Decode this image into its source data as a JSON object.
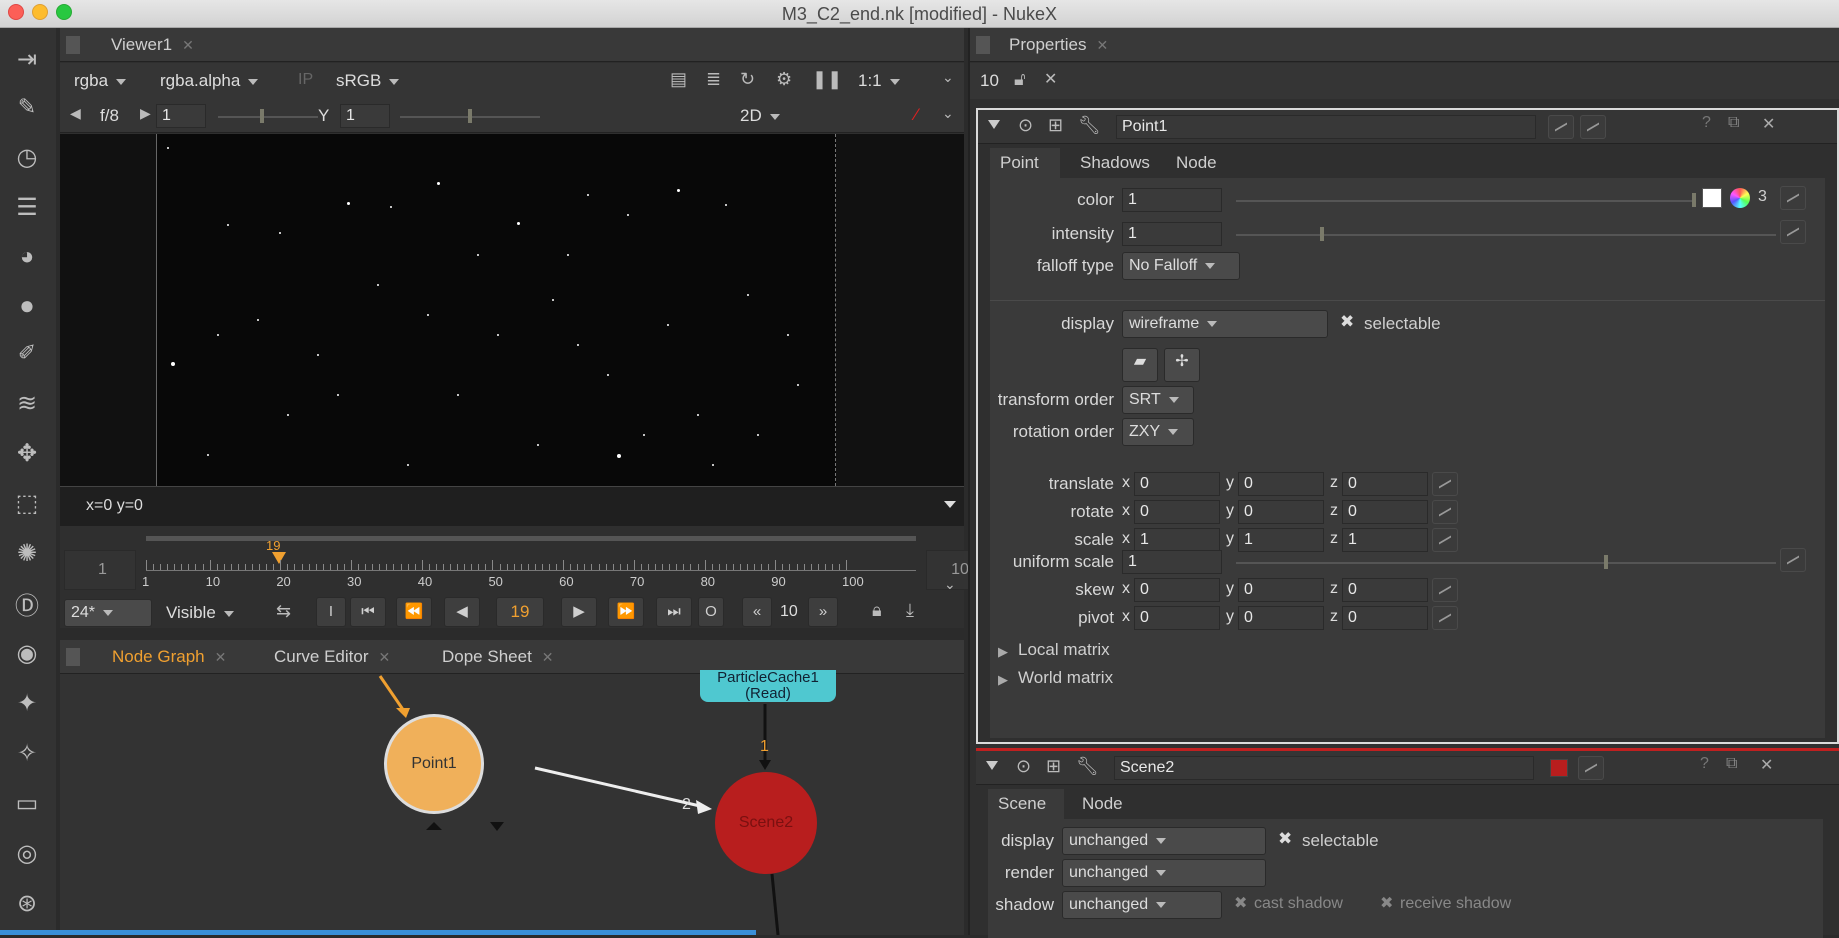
{
  "window": {
    "title": "M3_C2_end.nk [modified] - NukeX"
  },
  "viewer": {
    "tab_label": "Viewer1",
    "channels": "rgba",
    "alpha_channel": "rgba.alpha",
    "ip_label": "IP",
    "colorspace": "sRGB",
    "zoom": "1:1",
    "fstop": "f/8",
    "gain_value": "1",
    "gamma_label": "Y",
    "gamma_value": "1",
    "view_mode": "2D",
    "coords": "x=0 y=0"
  },
  "timeline": {
    "start_frame": "1",
    "end_frame": "100",
    "current_frame": "19",
    "tick_labels": [
      "1",
      "10",
      "20",
      "30",
      "40",
      "50",
      "60",
      "70",
      "80",
      "90",
      "100"
    ],
    "fps": "24*",
    "visible_mode": "Visible",
    "step_value": "10",
    "in_label": "I",
    "out_label": "O"
  },
  "lower_tabs": [
    "Node Graph",
    "Curve Editor",
    "Dope Sheet"
  ],
  "node_graph": {
    "nodes": [
      {
        "label": "Point1",
        "color": "#f0b05a"
      },
      {
        "label": "Scene2",
        "color": "#b81e1e"
      },
      {
        "label": "ParticleCache1",
        "sublabel": "(Read)",
        "color": "#4fc8d0"
      }
    ],
    "input_numbers": [
      "1",
      "2"
    ]
  },
  "properties": {
    "tab_label": "Properties",
    "max_panels": "10",
    "point_panel": {
      "name": "Point1",
      "tabs": [
        "Point",
        "Shadows",
        "Node"
      ],
      "color_value": "1",
      "color_channels": "3",
      "intensity_value": "1",
      "falloff_type_label": "falloff type",
      "falloff_type": "No Falloff",
      "display_label": "display",
      "display": "wireframe",
      "selectable_label": "selectable",
      "transform_order_label": "transform order",
      "transform_order": "SRT",
      "rotation_order_label": "rotation order",
      "rotation_order": "ZXY",
      "translate": {
        "label": "translate",
        "x": "0",
        "y": "0",
        "z": "0"
      },
      "rotate": {
        "label": "rotate",
        "x": "0",
        "y": "0",
        "z": "0"
      },
      "scale": {
        "label": "scale",
        "x": "1",
        "y": "1",
        "z": "1"
      },
      "uniform_scale_label": "uniform scale",
      "uniform_scale": "1",
      "skew": {
        "label": "skew",
        "x": "0",
        "y": "0",
        "z": "0"
      },
      "pivot": {
        "label": "pivot",
        "x": "0",
        "y": "0",
        "z": "0"
      },
      "local_matrix": "Local matrix",
      "world_matrix": "World matrix",
      "color_label": "color",
      "intensity_label": "intensity"
    },
    "scene_panel": {
      "name": "Scene2",
      "tabs": [
        "Scene",
        "Node"
      ],
      "display_label": "display",
      "display": "unchanged",
      "selectable_label": "selectable",
      "render_label": "render",
      "render": "unchanged",
      "shadow_label": "shadow",
      "shadow": "unchanged",
      "cast_shadow": "cast shadow",
      "receive_shadow": "receive shadow"
    }
  },
  "axis_labels": {
    "x": "x",
    "y": "y",
    "z": "z"
  }
}
